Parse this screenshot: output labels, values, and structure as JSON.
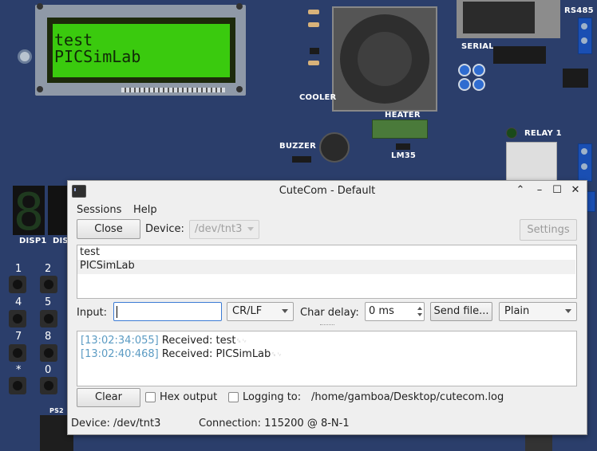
{
  "board": {
    "lcd_line1": "test",
    "lcd_line2": "PICSimLab",
    "labels": {
      "rs485": "RS485",
      "serial": "SERIAL",
      "cooler": "COOLER",
      "heater": "HEATER",
      "buzzer": "BUZZER",
      "lm35": "LM35",
      "relay1": "RELAY 1",
      "disp1": "DISP1",
      "disp2": "DIS",
      "ps2": "PS2"
    },
    "keypad": [
      "1",
      "2",
      "4",
      "5",
      "7",
      "8",
      "*",
      "0"
    ]
  },
  "window": {
    "title": "CuteCom - Default",
    "controls": {
      "up": "⌃",
      "minimize": "–",
      "maximize": "☐",
      "close": "✕"
    }
  },
  "menu": {
    "sessions": "Sessions",
    "help": "Help"
  },
  "toolbar": {
    "close_label": "Close",
    "device_label": "Device:",
    "device_value": "/dev/tnt3",
    "settings_label": "Settings"
  },
  "history": [
    "test",
    "PICSimLab"
  ],
  "input_row": {
    "input_label": "Input:",
    "input_value": "",
    "line_end": "CR/LF",
    "char_delay_label": "Char delay:",
    "char_delay_value": "0 ms",
    "send_file_label": "Send file...",
    "format": "Plain"
  },
  "log": [
    {
      "timestamp": "[13:02:34:055]",
      "text": "Received: test",
      "ctrl": "␍␊"
    },
    {
      "timestamp": "[13:02:40:468]",
      "text": "Received: PICSimLab",
      "ctrl": "␍␊"
    }
  ],
  "bottom": {
    "clear_label": "Clear",
    "hex_output_label": "Hex output",
    "logging_label": "Logging to:",
    "log_path": "/home/gamboa/Desktop/cutecom.log"
  },
  "status": {
    "device": "Device:  /dev/tnt3",
    "connection": "Connection:  115200 @ 8-N-1"
  },
  "colors": {
    "pcb": "#2b3e6b",
    "lcd_green": "#3aca0e",
    "timestamp": "#5b9bc3"
  }
}
